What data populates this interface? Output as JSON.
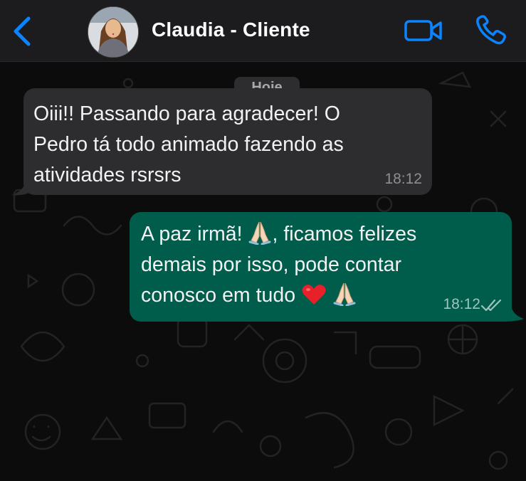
{
  "header": {
    "contact_name": "Claudia - Cliente",
    "icons": {
      "back": "chevron-left-icon",
      "video": "video-call-icon",
      "call": "phone-icon"
    },
    "accent_color": "#0a84ff"
  },
  "chat": {
    "date_chip": "Hoje",
    "messages": [
      {
        "direction": "incoming",
        "lines": [
          "Oiii!! Passando para agradecer! O",
          "Pedro tá todo animado fazendo as",
          "atividades rsrsrs"
        ],
        "time": "18:12",
        "bubble_color": "#2d2d30"
      },
      {
        "direction": "outgoing",
        "line1_before": "A paz irmã! ",
        "line1_after": ", ficamos felizes",
        "line2": "demais por isso, pode contar",
        "line3": "conosco em tudo ",
        "emojis": [
          "folded-hands-emoji",
          "red-heart-emoji",
          "folded-hands-emoji"
        ],
        "time": "18:12",
        "status": "double-check-icon",
        "bubble_color": "#005c4b"
      }
    ]
  }
}
